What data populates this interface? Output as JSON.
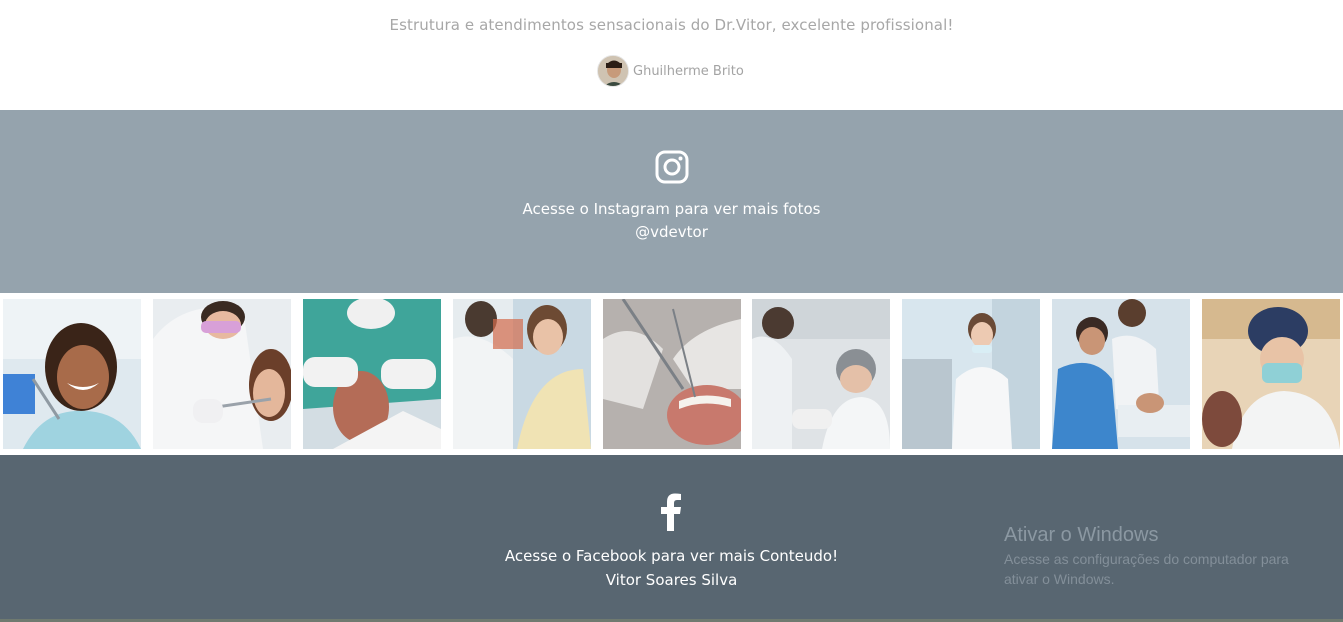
{
  "testimonial": {
    "quote": "Estrutura e atendimentos sensacionais do Dr.Vitor, excelente profissional!",
    "author": "Ghuilherme Brito"
  },
  "instagram": {
    "icon": "instagram-icon",
    "line1": "Acesse o Instagram para ver mais fotos",
    "handle": "@vdevtor"
  },
  "gallery": {
    "photos": [
      {
        "alt": "smiling patient in dental chair"
      },
      {
        "alt": "dentist examining patient"
      },
      {
        "alt": "dentist treating patient"
      },
      {
        "alt": "patient smiling with dentist"
      },
      {
        "alt": "dental instruments close-up"
      },
      {
        "alt": "dentists performing procedure"
      },
      {
        "alt": "dentist standing in clinic"
      },
      {
        "alt": "dental team with patient"
      },
      {
        "alt": "dentist with mask and cap"
      }
    ]
  },
  "facebook": {
    "icon": "facebook-icon",
    "line1": "Acesse o Facebook para ver mais Conteudo!",
    "name": "Vitor Soares Silva"
  },
  "watermark": {
    "title": "Ativar o Windows",
    "line1": "Acesse as configurações do computador para",
    "line2": "ativar o Windows."
  },
  "colors": {
    "instagram_band": "#95a3ad",
    "facebook_band": "#586671",
    "quote_text": "#a7a7a7"
  }
}
